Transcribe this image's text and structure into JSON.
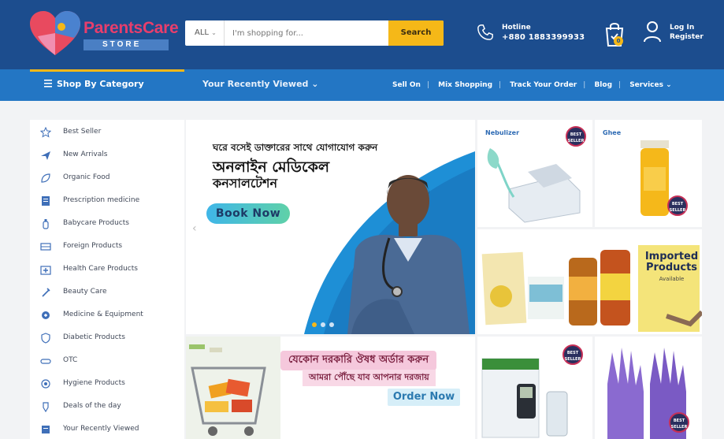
{
  "header": {
    "logo_name": "ParentsCare",
    "logo_sub": "STORE",
    "search_category": "ALL",
    "search_placeholder": "I'm shopping for...",
    "search_button": "Search",
    "hotline_label": "Hotline",
    "hotline_number": "+880 1883399933",
    "cart_count": "0",
    "login_label": "Log In",
    "register_label": "Register"
  },
  "nav": {
    "shop_by_category": "Shop By Category",
    "recently_viewed": "Your Recently Viewed",
    "links": [
      "Sell On",
      "Mix Shopping",
      "Track Your Order",
      "Blog",
      "Services"
    ]
  },
  "sidebar": {
    "items": [
      {
        "label": "Best Seller",
        "icon": "star-icon"
      },
      {
        "label": "New Arrivals",
        "icon": "plane-icon"
      },
      {
        "label": "Organic Food",
        "icon": "leaf-icon"
      },
      {
        "label": "Prescription medicine",
        "icon": "prescription-icon"
      },
      {
        "label": "Babycare Products",
        "icon": "baby-bottle-icon"
      },
      {
        "label": "Foreign Products",
        "icon": "globe-icon"
      },
      {
        "label": "Health Care Products",
        "icon": "medkit-icon"
      },
      {
        "label": "Beauty Care",
        "icon": "lipstick-icon"
      },
      {
        "label": "Medicine & Equipment",
        "icon": "stethoscope-icon"
      },
      {
        "label": "Diabetic Products",
        "icon": "shield-icon"
      },
      {
        "label": "OTC",
        "icon": "pill-icon"
      },
      {
        "label": "Hygiene Products",
        "icon": "soap-icon"
      },
      {
        "label": "Deals of the day",
        "icon": "tag-icon"
      },
      {
        "label": "Your Recently Viewed",
        "icon": "history-icon"
      }
    ]
  },
  "hero": {
    "line1": "ঘরে বসেই ডাক্তারের সাথে যোগাযোগ করুন",
    "line2": "অনলাইন মেডিকেল",
    "line3": "কনসালটেশন",
    "button": "Book Now"
  },
  "promo2": {
    "line1": "যেকোন দরকারি ঔষধ অর্ডার করুন",
    "line2": "আমরা পৌঁছে যাব আপনার দরজায়",
    "button": "Order Now"
  },
  "tiles": {
    "nebulizer": "Nebulizer",
    "ghee": "Ghee",
    "badge": "BEST SELLER",
    "imported_title": "Imported Products",
    "imported_sub": "Available"
  },
  "colors": {
    "header_bg": "#1c4d8e",
    "nav_bg": "#2376c4",
    "accent": "#f5b818",
    "brand_pink": "#e83e6c"
  }
}
